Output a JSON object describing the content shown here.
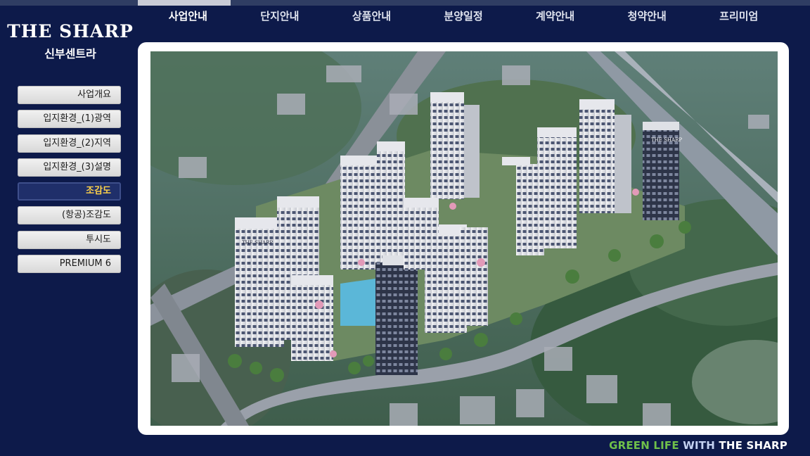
{
  "brand": {
    "name": "THE SHARP",
    "project": "신부센트라"
  },
  "topnav": [
    {
      "label": "사업안내",
      "active": true
    },
    {
      "label": "단지안내"
    },
    {
      "label": "상품안내"
    },
    {
      "label": "분양일정"
    },
    {
      "label": "계약안내"
    },
    {
      "label": "청약안내"
    },
    {
      "label": "프리미엄"
    }
  ],
  "sidemenu": [
    {
      "label": "사업개요"
    },
    {
      "label": "입지환경_(1)광역"
    },
    {
      "label": "입지환경_(2)지역"
    },
    {
      "label": "입지환경_(3)설명"
    },
    {
      "label": "조감도",
      "active": true
    },
    {
      "label": "(항공)조감도"
    },
    {
      "label": "투시도"
    },
    {
      "label": "PREMIUM 6"
    }
  ],
  "image": {
    "building_sign": "THE SHARP"
  },
  "footer": {
    "green": "GREEN LIFE",
    "with": "WITH",
    "brand": "THE SHARP"
  },
  "colors": {
    "background": "#0d1a4a",
    "active_menu": "#1f2f6a",
    "active_text": "#ffd34a",
    "slogan_green": "#6fc04a"
  }
}
